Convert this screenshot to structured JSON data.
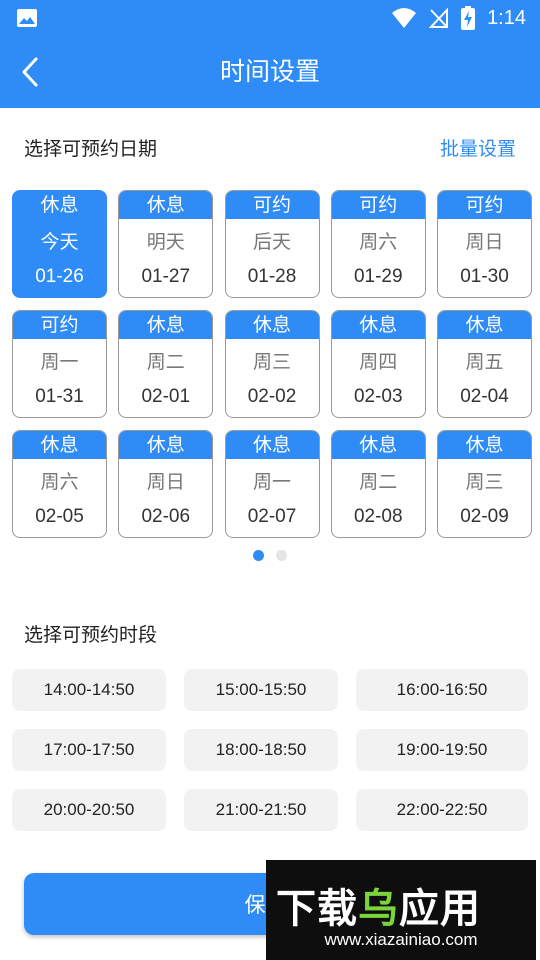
{
  "status_bar": {
    "time": "1:14",
    "icons": [
      "gallery-icon",
      "wifi-icon",
      "no-signal-icon",
      "battery-charging-icon"
    ]
  },
  "nav": {
    "title": "时间设置",
    "back_icon": "chevron-left-icon"
  },
  "date_section": {
    "title": "选择可预约日期",
    "batch_label": "批量设置",
    "cards": [
      {
        "status": "休息",
        "weekday": "今天",
        "date": "01-26",
        "selected": true
      },
      {
        "status": "休息",
        "weekday": "明天",
        "date": "01-27"
      },
      {
        "status": "可约",
        "weekday": "后天",
        "date": "01-28"
      },
      {
        "status": "可约",
        "weekday": "周六",
        "date": "01-29"
      },
      {
        "status": "可约",
        "weekday": "周日",
        "date": "01-30"
      },
      {
        "status": "可约",
        "weekday": "周一",
        "date": "01-31"
      },
      {
        "status": "休息",
        "weekday": "周二",
        "date": "02-01"
      },
      {
        "status": "休息",
        "weekday": "周三",
        "date": "02-02"
      },
      {
        "status": "休息",
        "weekday": "周四",
        "date": "02-03"
      },
      {
        "status": "休息",
        "weekday": "周五",
        "date": "02-04"
      },
      {
        "status": "休息",
        "weekday": "周六",
        "date": "02-05"
      },
      {
        "status": "休息",
        "weekday": "周日",
        "date": "02-06"
      },
      {
        "status": "休息",
        "weekday": "周一",
        "date": "02-07"
      },
      {
        "status": "休息",
        "weekday": "周二",
        "date": "02-08"
      },
      {
        "status": "休息",
        "weekday": "周三",
        "date": "02-09"
      }
    ],
    "pager": {
      "pages": 2,
      "active": 0
    }
  },
  "time_section": {
    "title": "选择可预约时段",
    "slots": [
      "14:00-14:50",
      "15:00-15:50",
      "16:00-16:50",
      "17:00-17:50",
      "18:00-18:50",
      "19:00-19:50",
      "20:00-20:50",
      "21:00-21:50",
      "22:00-22:50"
    ]
  },
  "save_button": {
    "label": "保"
  },
  "watermark": {
    "main_white": "下载",
    "main_green": "乌",
    "main_white2": "应用",
    "url": "www.xiazainiao.com"
  },
  "colors": {
    "accent": "#2f8cf6",
    "slot_bg": "#f2f2f2"
  }
}
